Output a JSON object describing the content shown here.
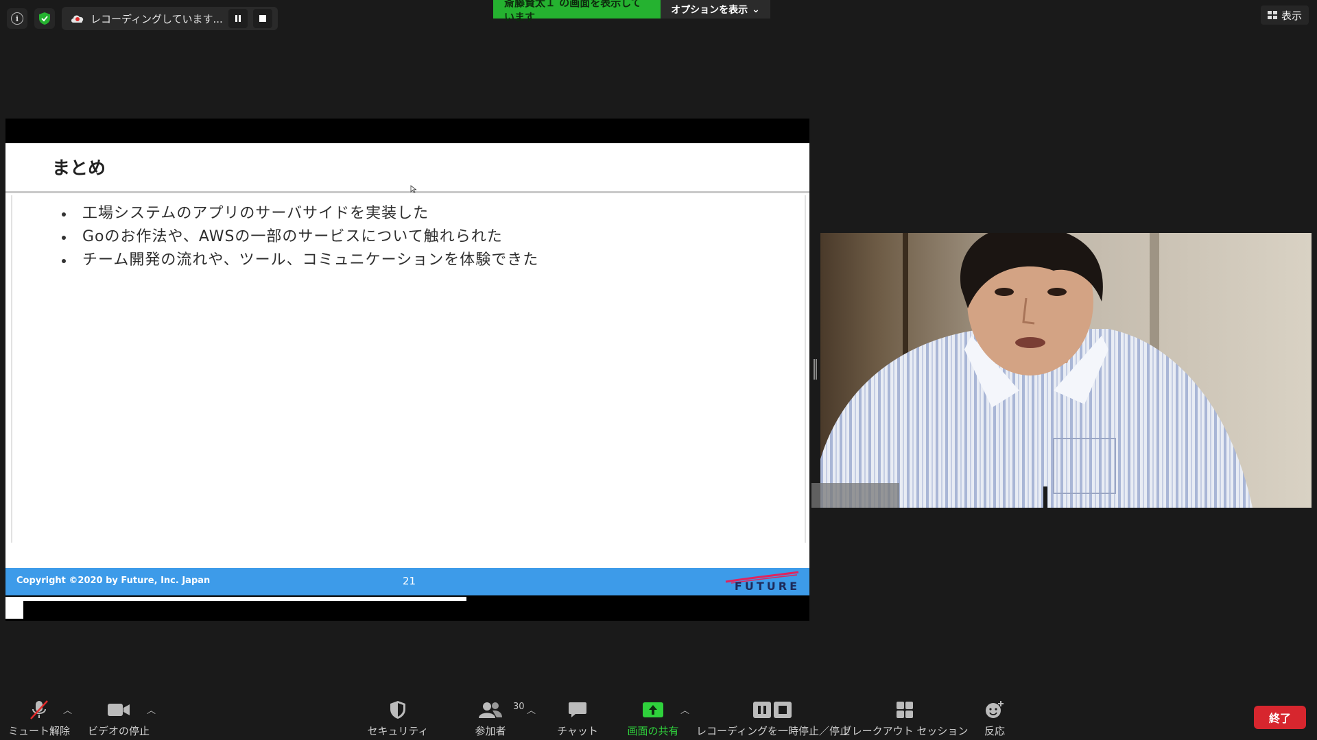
{
  "top_bar": {
    "recording_text": "レコーディングしています...",
    "share_banner": "斎藤賢太Ｉ の画面を表示しています",
    "options_label": "オプションを表示",
    "view_label": "表示"
  },
  "slide": {
    "title": "まとめ",
    "bullets": [
      "工場システムのアプリのサーバサイドを実装した",
      "Goのお作法や、AWSの一部のサービスについて触れられた",
      "チーム開発の流れや、ツール、コミュニケーションを体験できた"
    ],
    "copyright": "Copyright ©2020 by Future, Inc. Japan",
    "page_number": "21",
    "brand": "FUTURE"
  },
  "toolbar": {
    "unmute_label": "ミュート解除",
    "stop_video_label": "ビデオの停止",
    "security_label": "セキュリティ",
    "participants_label": "参加者",
    "participants_count": "30",
    "chat_label": "チャット",
    "share_label": "画面の共有",
    "recording_control_label": "レコーディングを一時停止／停止",
    "breakout_label": "ブレークアウト セッション",
    "reactions_label": "反応",
    "end_label": "終了"
  },
  "colors": {
    "background": "#1a1a1a",
    "share_green": "#25b230",
    "footer_blue": "#3d9be9",
    "end_red": "#d7262e"
  }
}
